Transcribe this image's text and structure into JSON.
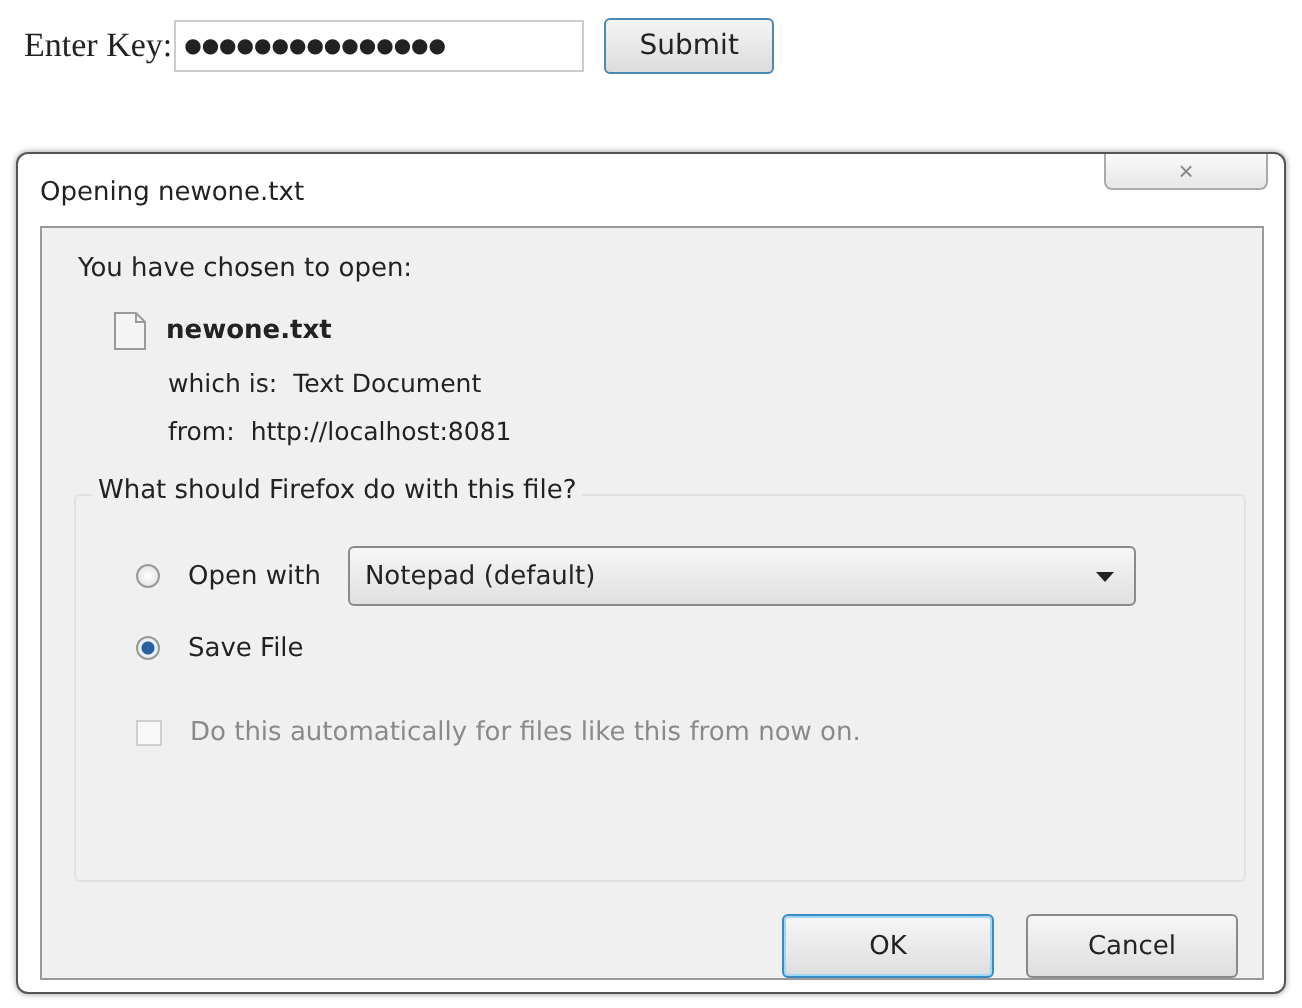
{
  "form": {
    "label": "Enter Key:",
    "value": "●●●●●●●●●●●●●●●",
    "submit": "Submit"
  },
  "dialog": {
    "title": "Opening newone.txt",
    "close": "×",
    "intro": "You have chosen to open:",
    "file": {
      "name": "newone.txt",
      "type_label": "which is:",
      "type": "Text Document",
      "from_label": "from:",
      "from": "http://localhost:8081"
    },
    "question": "What should Firefox do with this file?",
    "options": [
      {
        "kind": "radio",
        "label": "Open with",
        "selected": false,
        "dropdown": "Notepad (default)"
      },
      {
        "kind": "radio",
        "label": "Save File",
        "selected": true
      }
    ],
    "auto": {
      "label": "Do this automatically for files like this from now on.",
      "checked": false,
      "disabled": true
    },
    "buttons": [
      {
        "label": "OK",
        "default": true
      },
      {
        "label": "Cancel",
        "default": false
      }
    ]
  }
}
